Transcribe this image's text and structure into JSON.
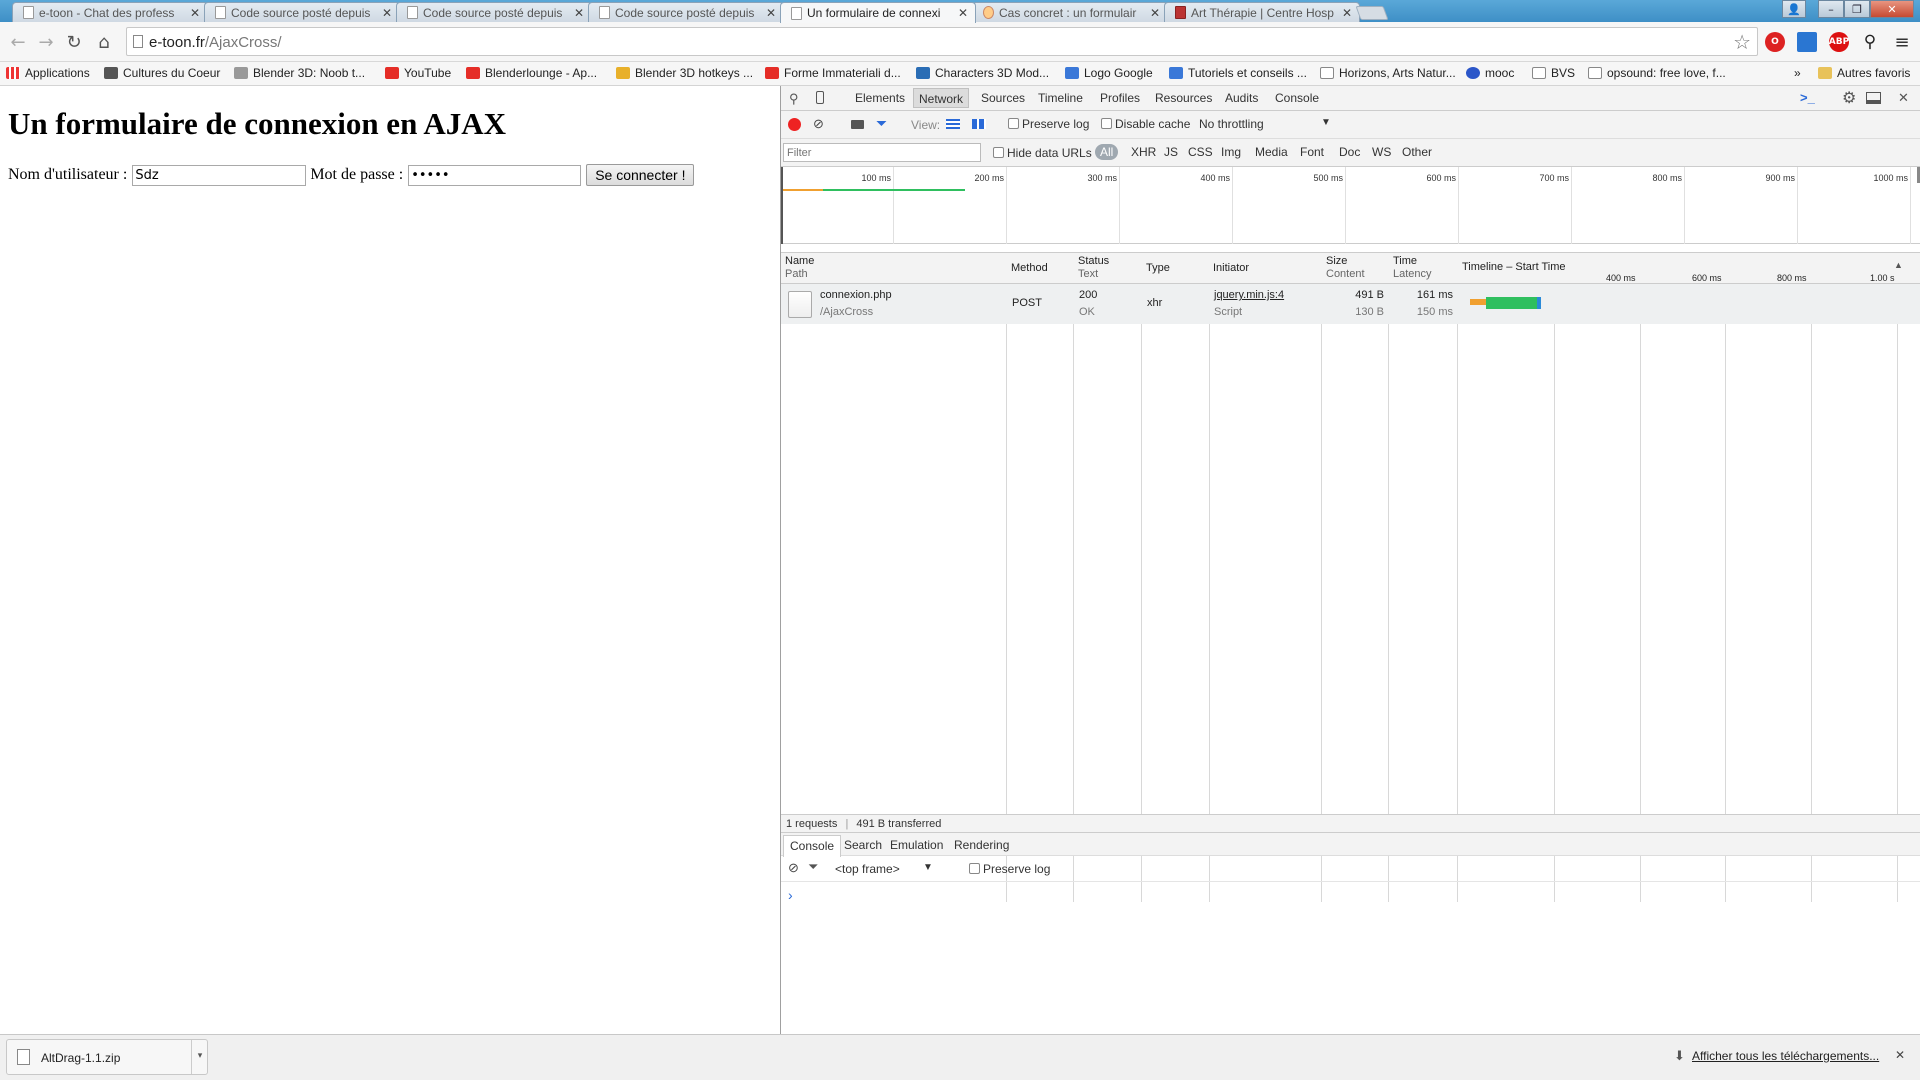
{
  "tabs": [
    {
      "title": "e-toon - Chat des profess"
    },
    {
      "title": "Code source posté depuis"
    },
    {
      "title": "Code source posté depuis"
    },
    {
      "title": "Code source posté depuis"
    },
    {
      "title": "Un formulaire de connexi"
    },
    {
      "title": "Cas concret : un formulair"
    },
    {
      "title": "Art Thérapie | Centre Hosp"
    }
  ],
  "window_buttons": {
    "minimize": "–",
    "restore": "❐",
    "close": "✕",
    "user": "👤"
  },
  "omnibox": {
    "domain": "e-toon.fr",
    "path": "/AjaxCross/"
  },
  "bookmarks": [
    {
      "label": "Applications",
      "color": "#e44"
    },
    {
      "label": "Cultures du Coeur",
      "color": "#333"
    },
    {
      "label": "Blender 3D: Noob t...",
      "color": "#666"
    },
    {
      "label": "YouTube",
      "color": "#e52d27"
    },
    {
      "label": "Blenderlounge - Ap...",
      "color": "#e52d27"
    },
    {
      "label": "Blender 3D hotkeys ...",
      "color": "#e8b02a"
    },
    {
      "label": "Forme Immateriali d...",
      "color": "#e52d27"
    },
    {
      "label": "Characters 3D Mod...",
      "color": "#2a6db5"
    },
    {
      "label": "Logo Google",
      "color": "#3a78d8"
    },
    {
      "label": "Tutoriels et conseils ...",
      "color": "#3a78d8"
    },
    {
      "label": "Horizons, Arts Natur...",
      "color": "#888"
    },
    {
      "label": "mooc",
      "color": "#2b56c9"
    },
    {
      "label": "BVS",
      "color": "#888"
    },
    {
      "label": "opsound: free love, f...",
      "color": "#888"
    }
  ],
  "bookmarks_more": "»",
  "bookmarks_other": "Autres favoris",
  "page": {
    "heading": "Un formulaire de connexion en AJAX",
    "username_label": "Nom d'utilisateur :",
    "username_value": "Sdz",
    "password_label": "Mot de passe :",
    "password_value": "•••••",
    "submit_label": "Se connecter !"
  },
  "devtools": {
    "tabs": [
      "Elements",
      "Network",
      "Sources",
      "Timeline",
      "Profiles",
      "Resources",
      "Audits",
      "Console"
    ],
    "selected_tab": "Network",
    "view_label": "View:",
    "preserve_log": "Preserve log",
    "disable_cache": "Disable cache",
    "throttling": "No throttling",
    "filter_placeholder": "Filter",
    "hide_data_urls": "Hide data URLs",
    "type_filters": [
      "All",
      "XHR",
      "JS",
      "CSS",
      "Img",
      "Media",
      "Font",
      "Doc",
      "WS",
      "Other"
    ],
    "overview_ticks": [
      "100 ms",
      "200 ms",
      "300 ms",
      "400 ms",
      "500 ms",
      "600 ms",
      "700 ms",
      "800 ms",
      "900 ms",
      "1000 ms"
    ],
    "columns": [
      {
        "top": "Name",
        "sub": "Path"
      },
      {
        "top": "Method",
        "sub": ""
      },
      {
        "top": "Status",
        "sub": "Text"
      },
      {
        "top": "Type",
        "sub": ""
      },
      {
        "top": "Initiator",
        "sub": ""
      },
      {
        "top": "Size",
        "sub": "Content"
      },
      {
        "top": "Time",
        "sub": "Latency"
      },
      {
        "top": "Timeline – Start Time",
        "sub": ""
      }
    ],
    "timeline_ticks": [
      "400 ms",
      "600 ms",
      "800 ms",
      "1.00 s"
    ],
    "request": {
      "name": "connexion.php",
      "path": "/AjaxCross",
      "method": "POST",
      "status": "200",
      "status_text": "OK",
      "type": "xhr",
      "initiator": "jquery.min.js:4",
      "initiator_type": "Script",
      "size": "491 B",
      "content": "130 B",
      "time": "161 ms",
      "latency": "150 ms"
    },
    "summary_requests": "1 requests",
    "summary_sep": "|",
    "summary_transferred": "491 B transferred",
    "drawer_tabs": [
      "Console",
      "Search",
      "Emulation",
      "Rendering"
    ],
    "console_context": "<top frame>",
    "console_preserve_log": "Preserve log",
    "console_prompt": "›"
  },
  "downloads": {
    "file": "AltDrag-1.1.zip",
    "show_all": "Afficher tous les téléchargements...",
    "close": "✕"
  }
}
